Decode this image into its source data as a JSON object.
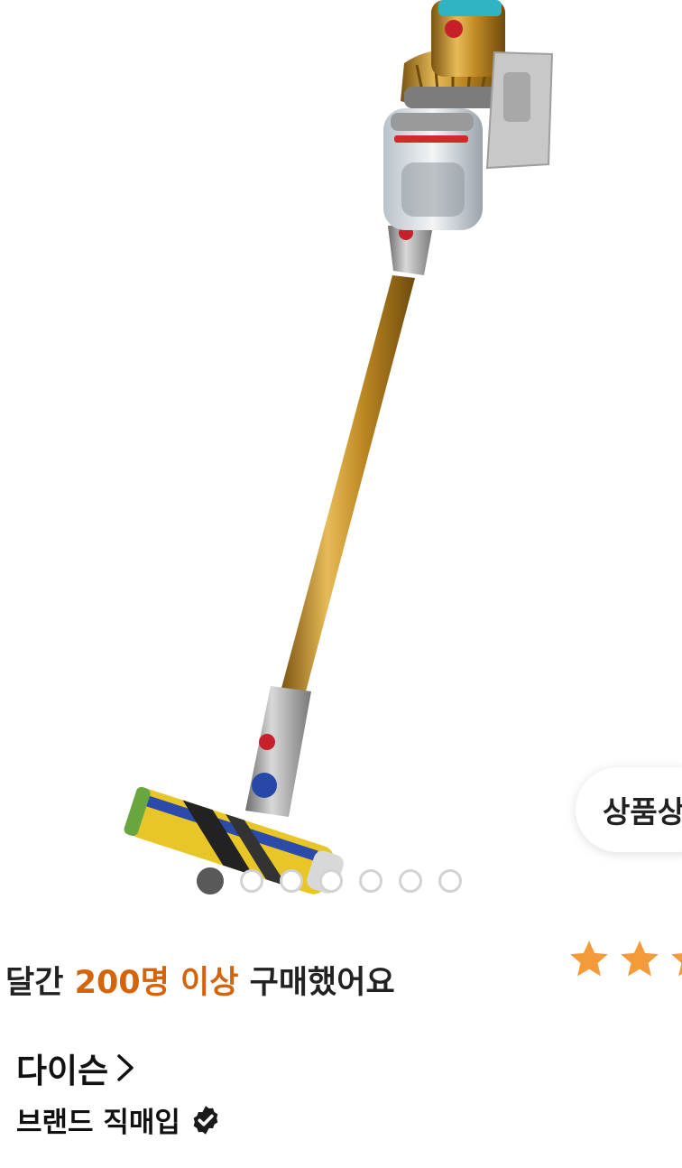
{
  "product": {
    "image_alt": "Dyson cordless stick vacuum",
    "carousel": {
      "total": 7,
      "active_index": 0
    },
    "detail_button_label": "상품상"
  },
  "purchase": {
    "prefix": "달간 ",
    "highlight": "200명 이상",
    "suffix": " 구매했어요"
  },
  "rating": {
    "visible_stars": 3,
    "star_color": "#f39a3b"
  },
  "brand": {
    "name": "다이슨",
    "badge_label": "브랜드 직매입",
    "badge_icon": "verified-check-icon"
  },
  "colors": {
    "accent": "#d4640a",
    "dot_active": "#595959",
    "dot_inactive": "#d2d2d2"
  }
}
